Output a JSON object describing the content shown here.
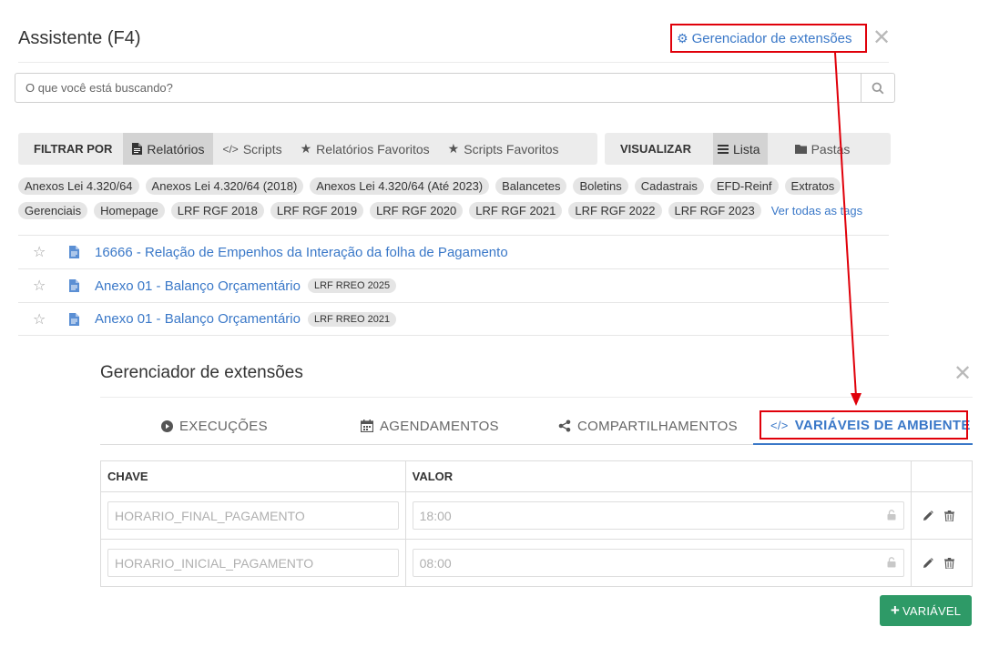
{
  "assistant": {
    "title": "Assistente (F4)",
    "extensions_link": "Gerenciador de extensões",
    "close_symbol": "✕",
    "search_placeholder": "O que você está buscando?",
    "filter_label": "FILTRAR POR",
    "filters": [
      {
        "label": "Relatórios",
        "icon": "file-icon"
      },
      {
        "label": "Scripts",
        "icon": "code-icon"
      },
      {
        "label": "Relatórios Favoritos",
        "icon": "star-icon"
      },
      {
        "label": "Scripts Favoritos",
        "icon": "star-icon"
      }
    ],
    "view_label": "VISUALIZAR",
    "views": [
      {
        "label": "Lista",
        "icon": "list-icon"
      },
      {
        "label": "Pastas",
        "icon": "folder-icon"
      }
    ],
    "tags_row1": [
      "Anexos Lei 4.320/64",
      "Anexos Lei 4.320/64 (2018)",
      "Anexos Lei 4.320/64 (Até 2023)",
      "Balancetes",
      "Boletins",
      "Cadastrais",
      "EFD-Reinf",
      "Extratos"
    ],
    "tags_row2": [
      "Gerenciais",
      "Homepage",
      "LRF RGF 2018",
      "LRF RGF 2019",
      "LRF RGF 2020",
      "LRF RGF 2021",
      "LRF RGF 2022",
      "LRF RGF 2023"
    ],
    "see_all_tags": "Ver todas as tags",
    "reports": [
      {
        "title": "16666 - Relação de Empenhos da Interação da folha de Pagamento",
        "tag": ""
      },
      {
        "title": "Anexo 01 - Balanço Orçamentário",
        "tag": "LRF RREO 2025"
      },
      {
        "title": "Anexo 01 - Balanço Orçamentário",
        "tag": "LRF RREO 2021"
      }
    ]
  },
  "extension_manager": {
    "title": "Gerenciador de extensões",
    "close_symbol": "✕",
    "tabs": [
      {
        "label": "EXECUÇÕES",
        "icon": "play-circle-icon"
      },
      {
        "label": "AGENDAMENTOS",
        "icon": "calendar-icon"
      },
      {
        "label": "COMPARTILHAMENTOS",
        "icon": "share-icon"
      },
      {
        "label": "VARIÁVEIS DE AMBIENTE",
        "icon": "code-icon"
      }
    ],
    "active_tab": "VARIÁVEIS DE AMBIENTE",
    "table": {
      "headers": [
        "CHAVE",
        "VALOR"
      ],
      "rows": [
        {
          "key": "HORARIO_FINAL_PAGAMENTO",
          "value": "18:00"
        },
        {
          "key": "HORARIO_INICIAL_PAGAMENTO",
          "value": "08:00"
        }
      ]
    },
    "add_button": "VARIÁVEL",
    "add_symbol": "+"
  },
  "colors": {
    "link_blue": "#3a78c8",
    "highlight_red": "#e0000a",
    "add_green": "#2e9a67"
  }
}
